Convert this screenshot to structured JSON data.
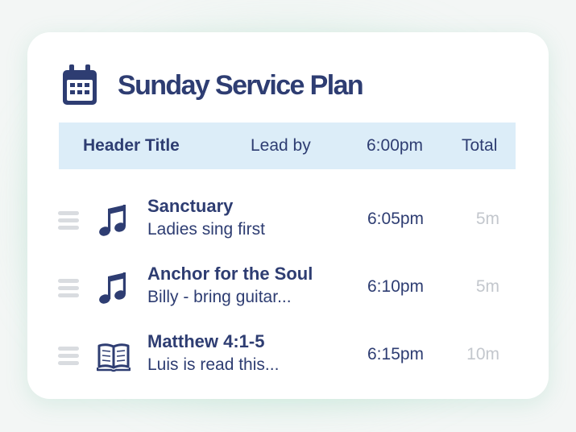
{
  "plan": {
    "title": "Sunday Service Plan",
    "icon": "calendar-icon"
  },
  "header": {
    "title": "Header Title",
    "lead": "Lead by",
    "time": "6:00pm",
    "total": "Total"
  },
  "items": [
    {
      "icon": "music-note-icon",
      "title": "Sanctuary",
      "note": "Ladies sing first",
      "time": "6:05pm",
      "duration": "5m"
    },
    {
      "icon": "music-note-icon",
      "title": "Anchor for the Soul",
      "note": "Billy - bring guitar...",
      "time": "6:10pm",
      "duration": "5m"
    },
    {
      "icon": "open-book-icon",
      "title": "Matthew 4:1-5",
      "note": "Luis is read this...",
      "time": "6:15pm",
      "duration": "10m"
    }
  ],
  "colors": {
    "text": "#2e3d72",
    "header_bg": "#dcedf8",
    "muted": "#c3c7cd",
    "handle": "#d9dce0",
    "glow": "#96debe"
  }
}
